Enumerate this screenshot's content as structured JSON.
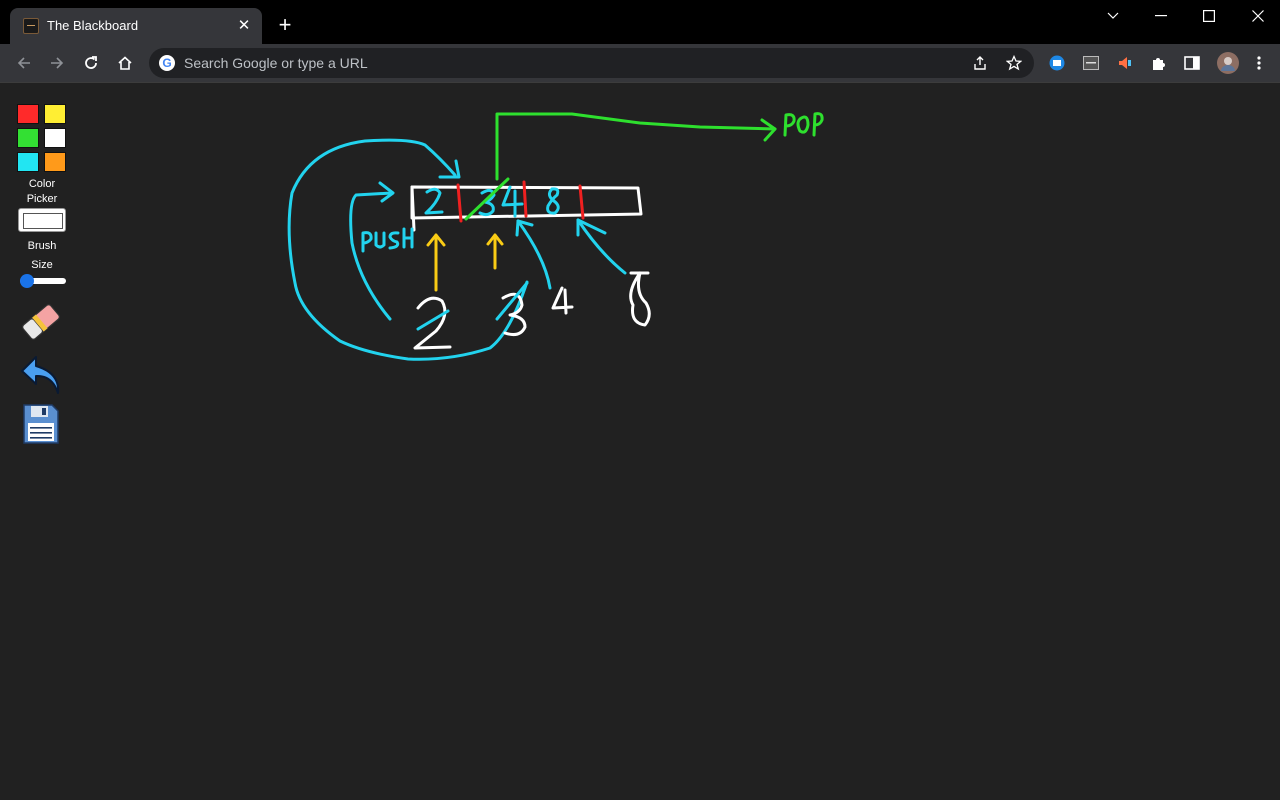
{
  "browser": {
    "tab_title": "The Blackboard",
    "omnibox_placeholder": "Search Google or type a URL",
    "google_letter": "G"
  },
  "sidebar": {
    "swatches": [
      "#ff2a2a",
      "#ffee33",
      "#33e033",
      "#ffffff",
      "#22e5f2",
      "#ff9a1a"
    ],
    "color_picker_label_line1": "Color",
    "color_picker_label_line2": "Picker",
    "brush_size_label_line1": "Brush",
    "brush_size_label_line2": "Size",
    "brush_size": 0
  },
  "colors": {
    "accent": "#1a73e8",
    "board_background": "#212121"
  }
}
